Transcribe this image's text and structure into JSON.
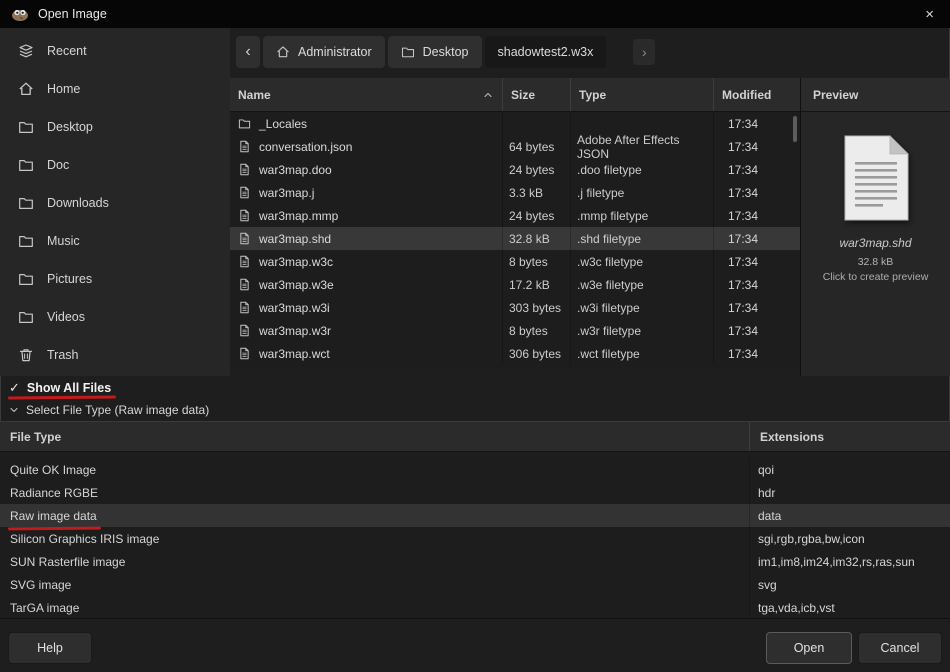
{
  "window": {
    "title": "Open Image"
  },
  "icons": {
    "app": "gimp-wilber",
    "close": "×",
    "back": "‹",
    "forward": "›",
    "check": "✓",
    "sort": "chevron-up",
    "expander": "chevron-down"
  },
  "sidebar": {
    "items": [
      {
        "label": "Recent",
        "icon": "recent-icon"
      },
      {
        "label": "Home",
        "icon": "home-icon"
      },
      {
        "label": "Desktop",
        "icon": "folder-icon"
      },
      {
        "label": "Doc",
        "icon": "folder-icon"
      },
      {
        "label": "Downloads",
        "icon": "folder-icon"
      },
      {
        "label": "Music",
        "icon": "folder-icon"
      },
      {
        "label": "Pictures",
        "icon": "folder-icon"
      },
      {
        "label": "Videos",
        "icon": "folder-icon"
      },
      {
        "label": "Trash",
        "icon": "trash-icon"
      }
    ]
  },
  "breadcrumb": {
    "items": [
      {
        "label": "Administrator",
        "icon": "home-icon"
      },
      {
        "label": "Desktop",
        "icon": "folder-icon"
      },
      {
        "label": "shadowtest2.w3x",
        "icon": ""
      }
    ]
  },
  "file_list": {
    "columns": {
      "name": "Name",
      "size": "Size",
      "type": "Type",
      "modified": "Modified"
    },
    "rows": [
      {
        "name": "_Locales",
        "icon": "folder-icon",
        "size": "",
        "type": "",
        "modified": "17:34"
      },
      {
        "name": "conversation.json",
        "icon": "file-icon",
        "size": "64 bytes",
        "type": "Adobe After Effects JSON",
        "modified": "17:34"
      },
      {
        "name": "war3map.doo",
        "icon": "file-icon",
        "size": "24 bytes",
        "type": ".doo filetype",
        "modified": "17:34"
      },
      {
        "name": "war3map.j",
        "icon": "file-icon",
        "size": "3.3 kB",
        "type": ".j filetype",
        "modified": "17:34"
      },
      {
        "name": "war3map.mmp",
        "icon": "file-icon",
        "size": "24 bytes",
        "type": ".mmp filetype",
        "modified": "17:34"
      },
      {
        "name": "war3map.shd",
        "icon": "file-icon",
        "size": "32.8 kB",
        "type": ".shd filetype",
        "modified": "17:34",
        "selected": true
      },
      {
        "name": "war3map.w3c",
        "icon": "file-icon",
        "size": "8 bytes",
        "type": ".w3c filetype",
        "modified": "17:34"
      },
      {
        "name": "war3map.w3e",
        "icon": "file-icon",
        "size": "17.2 kB",
        "type": ".w3e filetype",
        "modified": "17:34"
      },
      {
        "name": "war3map.w3i",
        "icon": "file-icon",
        "size": "303 bytes",
        "type": ".w3i filetype",
        "modified": "17:34"
      },
      {
        "name": "war3map.w3r",
        "icon": "file-icon",
        "size": "8 bytes",
        "type": ".w3r filetype",
        "modified": "17:34"
      },
      {
        "name": "war3map.wct",
        "icon": "file-icon",
        "size": "306 bytes",
        "type": ".wct filetype",
        "modified": "17:34"
      }
    ]
  },
  "preview": {
    "header": "Preview",
    "filename": "war3map.shd",
    "filesize": "32.8 kB",
    "hint": "Click to create preview"
  },
  "filters": {
    "show_all_files": "Show All Files",
    "select_file_type": "Select File Type (Raw image data)"
  },
  "file_types": {
    "columns": {
      "type": "File Type",
      "ext": "Extensions"
    },
    "rows": [
      {
        "type": "Quite OK Image",
        "ext": "qoi"
      },
      {
        "type": "Radiance RGBE",
        "ext": "hdr"
      },
      {
        "type": "Raw image data",
        "ext": "data",
        "selected": true
      },
      {
        "type": "Silicon Graphics IRIS image",
        "ext": "sgi,rgb,rgba,bw,icon"
      },
      {
        "type": "SUN Rasterfile image",
        "ext": "im1,im8,im24,im32,rs,ras,sun"
      },
      {
        "type": "SVG image",
        "ext": "svg"
      },
      {
        "type": "TarGA image",
        "ext": "tga,vda,icb,vst"
      }
    ]
  },
  "footer": {
    "help": "Help",
    "open": "Open",
    "cancel": "Cancel"
  },
  "colors": {
    "annotation": "#c11b1b",
    "selection": "#383838"
  }
}
